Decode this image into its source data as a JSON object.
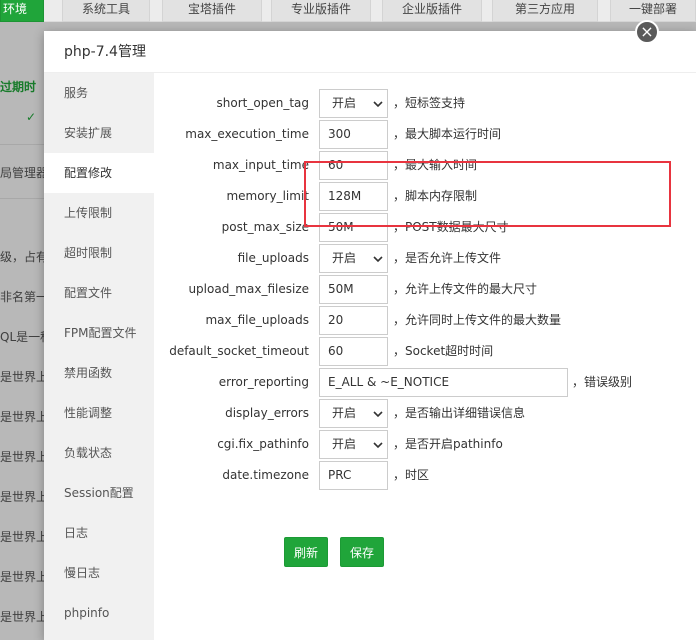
{
  "background": {
    "tabs": [
      {
        "label": "环境"
      },
      {
        "label": "系统工具"
      },
      {
        "label": "宝塔插件"
      },
      {
        "label": "专业版插件"
      },
      {
        "label": "企业版插件"
      },
      {
        "label": "第三方应用"
      },
      {
        "label": "一键部署"
      }
    ],
    "left_lines": [
      "过期时",
      "✓",
      "局管理器",
      "级，占有",
      "非名第一",
      "QL是一种",
      "是世界上",
      "是世界上",
      "是世界上",
      "是世界上",
      "是世界上",
      "是世界上",
      "是世界上"
    ]
  },
  "dialog": {
    "title": "php-7.4管理",
    "close_glyph": "×",
    "sidebar": [
      {
        "label": "服务"
      },
      {
        "label": "安装扩展"
      },
      {
        "label": "配置修改"
      },
      {
        "label": "上传限制"
      },
      {
        "label": "超时限制"
      },
      {
        "label": "配置文件"
      },
      {
        "label": "FPM配置文件"
      },
      {
        "label": "禁用函数"
      },
      {
        "label": "性能调整"
      },
      {
        "label": "负载状态"
      },
      {
        "label": "Session配置"
      },
      {
        "label": "日志"
      },
      {
        "label": "慢日志"
      },
      {
        "label": "phpinfo"
      }
    ],
    "active_sidebar": "配置修改",
    "settings": [
      {
        "name": "short_open_tag",
        "value": "开启",
        "type": "select",
        "desc": "，短标签支持"
      },
      {
        "name": "max_execution_time",
        "value": "300",
        "type": "input",
        "desc": "，最大脚本运行时间"
      },
      {
        "name": "max_input_time",
        "value": "60",
        "type": "input",
        "desc": "，最大输入时间"
      },
      {
        "name": "memory_limit",
        "value": "128M",
        "type": "input",
        "desc": "，脚本内存限制"
      },
      {
        "name": "post_max_size",
        "value": "50M",
        "type": "input",
        "desc": "，POST数据最大尺寸"
      },
      {
        "name": "file_uploads",
        "value": "开启",
        "type": "select",
        "desc": "，是否允许上传文件"
      },
      {
        "name": "upload_max_filesize",
        "value": "50M",
        "type": "input",
        "desc": "，允许上传文件的最大尺寸"
      },
      {
        "name": "max_file_uploads",
        "value": "20",
        "type": "input",
        "desc": "，允许同时上传文件的最大数量"
      },
      {
        "name": "default_socket_timeout",
        "value": "60",
        "type": "input",
        "desc": "，Socket超时时间"
      },
      {
        "name": "error_reporting",
        "value": "E_ALL & ~E_NOTICE",
        "type": "input-wide",
        "desc": "，错误级别"
      },
      {
        "name": "display_errors",
        "value": "开启",
        "type": "select",
        "desc": "，是否输出详细错误信息"
      },
      {
        "name": "cgi.fix_pathinfo",
        "value": "开启",
        "type": "select",
        "desc": "，是否开启pathinfo"
      },
      {
        "name": "date.timezone",
        "value": "PRC",
        "type": "input",
        "desc": "，时区"
      }
    ],
    "buttons": {
      "refresh": "刷新",
      "save": "保存"
    },
    "highlight_color": "#e8343f",
    "accent_color": "#20a53a"
  }
}
